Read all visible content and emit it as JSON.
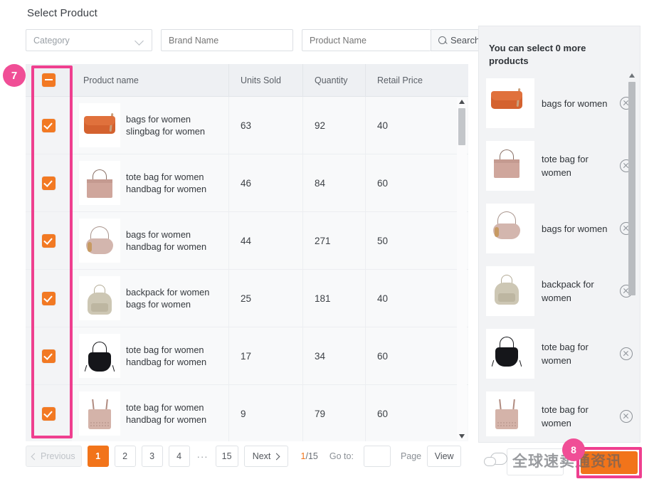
{
  "page": {
    "title": "Select Product"
  },
  "filters": {
    "category": {
      "value": "Category",
      "icon": "chevron-down-icon"
    },
    "brand": {
      "placeholder": "Brand Name",
      "value": ""
    },
    "product": {
      "placeholder": "Product Name",
      "value": ""
    },
    "search_button": {
      "label": "Search",
      "icon": "search-icon"
    }
  },
  "table": {
    "header_checkbox_state": "indeterminate",
    "columns": [
      "Product name",
      "Units Sold",
      "Quantity",
      "Retail Price"
    ],
    "rows": [
      {
        "checked": true,
        "name": "bags for women slingbag for women",
        "units_sold": "63",
        "quantity": "92",
        "retail_price": "40",
        "thumb": "orange-sling-bag"
      },
      {
        "checked": true,
        "name": "tote bag for women handbag for women",
        "units_sold": "46",
        "quantity": "84",
        "retail_price": "60",
        "thumb": "pink-tote-bag"
      },
      {
        "checked": true,
        "name": "bags for women handbag for women",
        "units_sold": "44",
        "quantity": "271",
        "retail_price": "50",
        "thumb": "blush-hobo-bag"
      },
      {
        "checked": true,
        "name": "backpack for women bags for women",
        "units_sold": "25",
        "quantity": "181",
        "retail_price": "40",
        "thumb": "floral-backpack"
      },
      {
        "checked": true,
        "name": "tote bag for women handbag for women",
        "units_sold": "17",
        "quantity": "34",
        "retail_price": "60",
        "thumb": "black-bucket-bag"
      },
      {
        "checked": true,
        "name": "tote bag for women handbag for women",
        "units_sold": "9",
        "quantity": "79",
        "retail_price": "60",
        "thumb": "perforated-tote-bag"
      }
    ]
  },
  "pagination": {
    "previous_label": "Previous",
    "pages": [
      "1",
      "2",
      "3",
      "4"
    ],
    "ellipsis": "···",
    "last_page": "15",
    "next_label": "Next",
    "active_page": "1",
    "current_of_total_current": "1",
    "current_of_total_sep": "/",
    "current_of_total_total": "15",
    "goto_label": "Go to:",
    "goto_value": "",
    "page_label": "Page",
    "view_label": "View"
  },
  "selected_panel": {
    "title": "You can select 0 more products",
    "items": [
      {
        "name": "bags for women",
        "thumb": "orange-sling-bag",
        "remove_icon": "close-circle-icon"
      },
      {
        "name": "tote bag for women",
        "thumb": "pink-tote-bag",
        "remove_icon": "close-circle-icon"
      },
      {
        "name": "bags for women",
        "thumb": "blush-hobo-bag",
        "remove_icon": "close-circle-icon"
      },
      {
        "name": "backpack for women",
        "thumb": "floral-backpack",
        "remove_icon": "close-circle-icon"
      },
      {
        "name": "tote bag for women",
        "thumb": "black-bucket-bag",
        "remove_icon": "close-circle-icon"
      },
      {
        "name": "tote bag for women",
        "thumb": "perforated-tote-bag",
        "remove_icon": "close-circle-icon"
      }
    ]
  },
  "annotations": {
    "badge_column": "7",
    "badge_button": "8",
    "highlight_color": "#ef3f8f",
    "badge_color": "#f04e96"
  },
  "watermark": {
    "text": "全球速卖通资讯",
    "logo": "speech-bubbles-icon"
  },
  "colors": {
    "accent_orange": "#f2741a",
    "checkbox_orange": "#f27923",
    "header_bg": "#eef0f3",
    "panel_bg": "#f2f3f5"
  }
}
